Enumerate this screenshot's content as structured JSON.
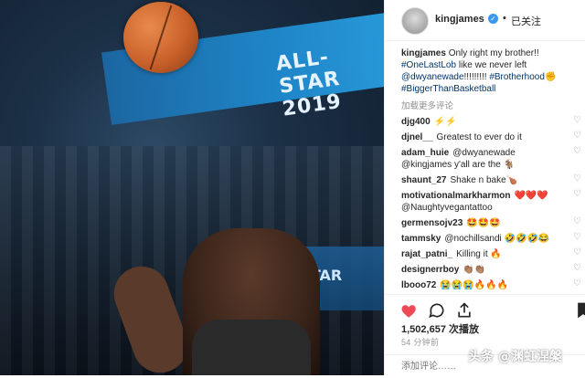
{
  "media": {
    "banner_text": "ALL-STAR 2019",
    "led_text": "ALL STAR"
  },
  "post": {
    "username": "kingjames",
    "follow_label": "已关注",
    "caption": {
      "user": "kingjames",
      "text1": "Only right my brother!!",
      "tag1": "#OneLastLob",
      "text2": "like we never left",
      "mention": "@dwyanewade",
      "text3": "!!!!!!!!!",
      "tag2": "#Brotherhood",
      "emoji": "✊",
      "tag3": "#BiggerThanBasketball"
    },
    "load_more": "加载更多评论",
    "comments": [
      {
        "user": "djg400",
        "text": "⚡⚡"
      },
      {
        "user": "djnel__",
        "text": "Greatest to ever do it"
      },
      {
        "user": "adam_huie",
        "text": "@dwyanewade @kingjames y'all are the 🐐"
      },
      {
        "user": "shaunt_27",
        "text": "Shake n bake🍗"
      },
      {
        "user": "motivationalmarkharmon",
        "text": "❤️❤️❤️ @Naughtyvegantattoo"
      },
      {
        "user": "germensojv23",
        "text": "🤩🤩🤩"
      },
      {
        "user": "tammsky",
        "text": "@nochillsandi 🤣🤣🤣😂"
      },
      {
        "user": "rajat_patni_",
        "text": "Killing it 🔥"
      },
      {
        "user": "designerrboy",
        "text": "👏🏽👏🏽"
      },
      {
        "user": "lbooo72",
        "text": "😭😭😭🔥🔥🔥"
      }
    ],
    "likes": "1,502,657 次播放",
    "time": "54 分钟前",
    "add_comment_placeholder": "添加评论……",
    "watermark": "头条 @渊虹涅槃"
  }
}
